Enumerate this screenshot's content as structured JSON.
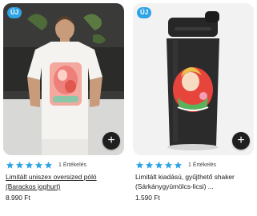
{
  "colors": {
    "badge_bg": "#2ea3e5",
    "star": "#2ea3e5",
    "button_bg": "#1f1f1f"
  },
  "products": [
    {
      "badge": "ÚJ",
      "image_icon": "tshirt-photo",
      "rating_stars": 5,
      "rating_count_text": "1 Értékelés",
      "title": "Limitált uniszex oversized póló (Barackos joghurt)",
      "price": "8.990 Ft",
      "add_label": "+"
    },
    {
      "badge": "ÚJ",
      "image_icon": "shaker-photo",
      "rating_stars": 5,
      "rating_count_text": "1 Értékelés",
      "title": "Limitált kiadású, gyűjthető shaker (Sárkánygyümölcs-licsi) ...",
      "price": "1.590 Ft",
      "add_label": "+"
    }
  ]
}
